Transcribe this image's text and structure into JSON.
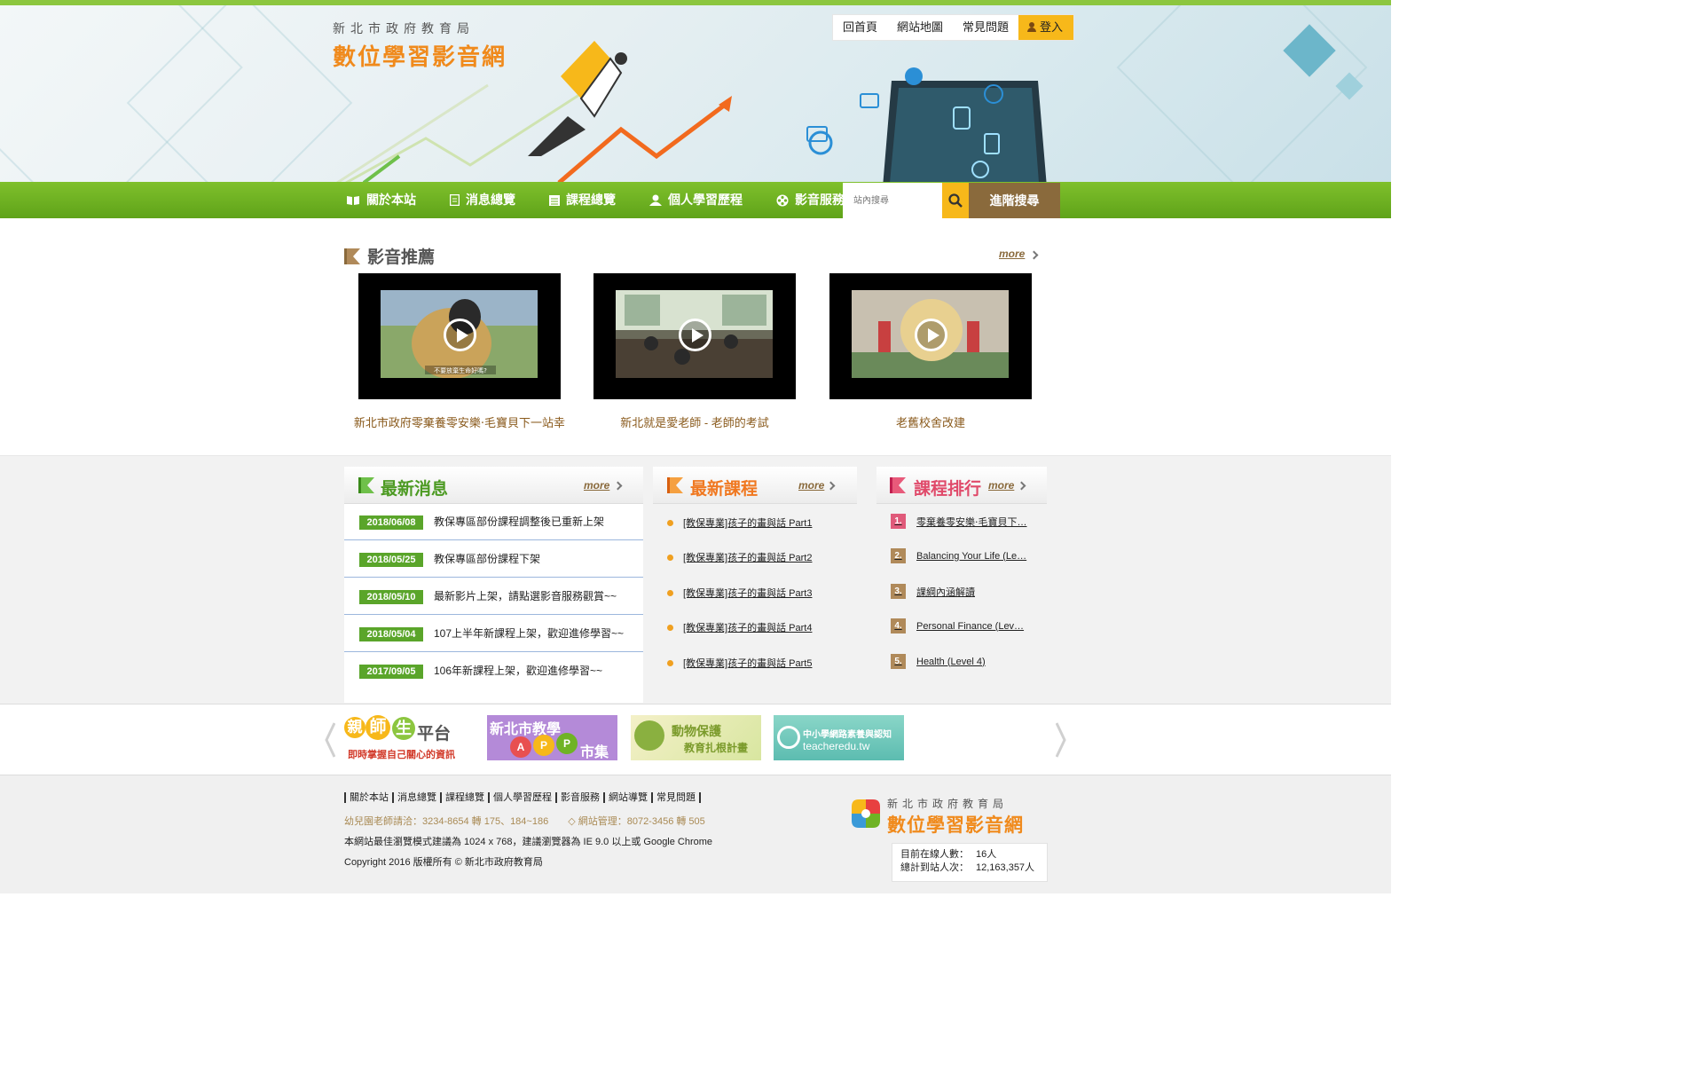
{
  "header": {
    "logo_sub": "新北市政府教育局",
    "logo_main": "數位學習影音網",
    "links": [
      "回首頁",
      "網站地圖",
      "常見問題"
    ],
    "login": "登入"
  },
  "nav": {
    "items": [
      {
        "label": "關於本站",
        "icon": "book-icon"
      },
      {
        "label": "消息總覽",
        "icon": "document-icon"
      },
      {
        "label": "課程總覽",
        "icon": "list-icon"
      },
      {
        "label": "個人學習歷程",
        "icon": "user-icon"
      },
      {
        "label": "影音服務",
        "icon": "film-reel-icon"
      }
    ],
    "search_placeholder": "站內搜尋",
    "advanced_search": "進階搜尋"
  },
  "featured": {
    "title": "影音推薦",
    "more": "more",
    "videos": [
      {
        "title": "新北市政府零棄養零安樂‧毛寶貝下一站幸",
        "subtitle": "不要放棄生命好嗎?"
      },
      {
        "title": "新北就是愛老師 - 老師的考試"
      },
      {
        "title": "老舊校舍改建"
      }
    ]
  },
  "news": {
    "title": "最新消息",
    "more": "more",
    "items": [
      {
        "date": "2018/06/08",
        "text": "教保專區部份課程調整後已重新上架"
      },
      {
        "date": "2018/05/25",
        "text": "教保專區部份課程下架"
      },
      {
        "date": "2018/05/10",
        "text": "最新影片上架，請點選影音服務觀賞~~"
      },
      {
        "date": "2018/05/04",
        "text": "107上半年新課程上架，歡迎進修學習~~"
      },
      {
        "date": "2017/09/05",
        "text": "106年新課程上架，歡迎進修學習~~"
      }
    ]
  },
  "courses": {
    "title": "最新課程",
    "more": "more",
    "items": [
      "[教保專業]孩子的畫與話 Part1",
      "[教保專業]孩子的畫與話 Part2",
      "[教保專業]孩子的畫與話 Part3",
      "[教保專業]孩子的畫與話 Part4",
      "[教保專業]孩子的畫與話 Part5"
    ]
  },
  "ranking": {
    "title": "課程排行",
    "more": "more",
    "items": [
      {
        "rank": "1.",
        "text": "零棄養零安樂‧毛寶貝下…",
        "color": "#e05a7a"
      },
      {
        "rank": "2.",
        "text": "Balancing Your Life (Le…",
        "color": "#b08a5a"
      },
      {
        "rank": "3.",
        "text": "課綱內涵解讀",
        "color": "#b08a5a"
      },
      {
        "rank": "4.",
        "text": "Personal Finance (Lev…",
        "color": "#b08a5a"
      },
      {
        "rank": "5.",
        "text": "Health (Level 4)",
        "color": "#b08a5a"
      }
    ]
  },
  "partners": {
    "p1_a": "親",
    "p1_b": "師",
    "p1_c": "生",
    "p1_d": "平台",
    "p1_sub": "即時掌握自己關心的資訊",
    "p2_title": "新北市教學",
    "p2_a": "A",
    "p2_b": "P",
    "p2_c": "P",
    "p2_sub": "市集",
    "p3_title": "動物保護",
    "p3_sub": "教育扎根計畫",
    "p4_title": "中小學網路素養與認知",
    "p4_sub": "teacheredu.tw"
  },
  "footer": {
    "links": [
      "關於本站",
      "消息總覽",
      "課程總覽",
      "個人學習歷程",
      "影音服務",
      "網站導覽",
      "常見問題"
    ],
    "contact": "幼兒園老師請洽：3234-8654 轉 175、184~186　　◇ 網站管理：8072-3456 轉 505",
    "browser": "本網站最佳瀏覽模式建議為 1024 x 768，建議瀏覽器為 IE 9.0 以上或 Google Chrome",
    "copyright": "Copyright 2016 版權所有 © 新北市政府教育局",
    "logo_sub": "新北市政府教育局",
    "logo_main": "數位學習影音網",
    "online_label": "目前在線人數：",
    "online_value": "16人",
    "visits_label": "總計到站人次：",
    "visits_value": "12,163,357人"
  },
  "colors": {
    "green": "#6fb324",
    "orange": "#f08a1c",
    "brown": "#8a6a3c",
    "yellow": "#f7b81a",
    "news_green": "#5aa52a",
    "course_orange": "#f07820",
    "ranking_pink": "#e04a6a"
  }
}
